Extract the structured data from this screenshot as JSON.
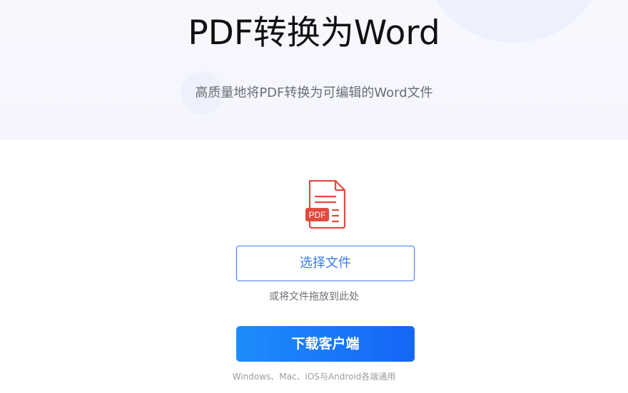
{
  "hero": {
    "title": "PDF转换为Word",
    "subtitle": "高质量地将PDF转换为可编辑的Word文件"
  },
  "upload": {
    "file_icon": "pdf-file-icon",
    "file_icon_badge": "PDF",
    "select_label": "选择文件",
    "drop_hint": "或将文件拖放到此处"
  },
  "download": {
    "label": "下载客户端",
    "platforms": "Windows、Mac、iOS与Android各端通用"
  },
  "colors": {
    "accent": "#3a7be8",
    "download_gradient_start": "#1d8cfb",
    "download_gradient_end": "#1566f5",
    "pdf_red": "#e34a3f"
  }
}
